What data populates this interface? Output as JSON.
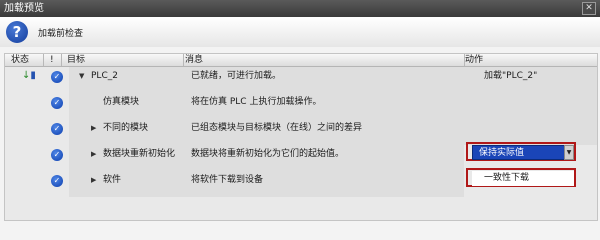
{
  "window": {
    "title": "加载预览",
    "close": "✕"
  },
  "header": {
    "text": "加载前检查"
  },
  "columns": {
    "status": "状态",
    "bang": "!",
    "target": "目标",
    "message": "消息",
    "action": "动作"
  },
  "rows": [
    {
      "target": "PLC_2",
      "message": "已就绪，可进行加载。",
      "action": "加载\"PLC_2\""
    },
    {
      "target": "仿真模块",
      "message": "将在仿真 PLC 上执行加载操作。",
      "action": ""
    },
    {
      "target": "不同的模块",
      "message": "已组态模块与目标模块（在线）之间的差异",
      "action": ""
    },
    {
      "target": "数据块重新初始化",
      "message": "数据块将重新初始化为它们的起始值。",
      "action": "保持实际值"
    },
    {
      "target": "软件",
      "message": "将软件下载到设备",
      "action": "一致性下载"
    }
  ]
}
